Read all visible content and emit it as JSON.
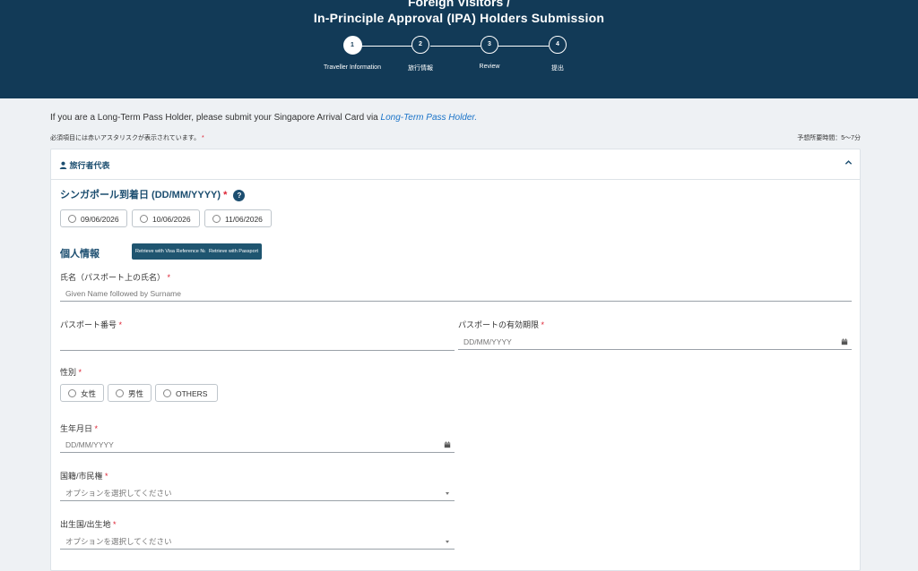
{
  "header": {
    "title_line1": "Foreign Visitors /",
    "title_line2": "In-Principle Approval (IPA) Holders Submission",
    "steps": [
      {
        "number": "1",
        "label": "Traveller Information"
      },
      {
        "number": "2",
        "label": "旅行情報"
      },
      {
        "number": "3",
        "label": "Review"
      },
      {
        "number": "4",
        "label": "提出"
      }
    ]
  },
  "notice": {
    "text": "If you are a Long-Term Pass Holder, please submit your Singapore Arrival Card via ",
    "link": "Long-Term Pass Holder."
  },
  "required_note": "必須項目には赤いアスタリスクが表示されています。",
  "required_star": "*",
  "time_estimate": "予想所要時間：5〜7分",
  "section": {
    "title": "旅行者代表",
    "arrival_label": "シンガポール到着日 (DD/MM/YYYY)",
    "info_symbol": "?",
    "arrival_options": [
      "09/06/2026",
      "10/06/2026",
      "11/06/2026"
    ],
    "personal_label": "個人情報",
    "retrieve_visa": "Retrieve with Visa Reference Number",
    "retrieve_passport": "Retrieve with Passport",
    "name_label": "氏名（パスポート上の氏名）",
    "name_placeholder": "Given Name followed by Surname",
    "passport_number_label": "パスポート番号",
    "passport_number_value": "",
    "passport_expiry_label": "パスポートの有効期限",
    "passport_expiry_placeholder": "DD/MM/YYYY",
    "gender_label": "性別",
    "gender_options": [
      "女性",
      "男性",
      "OTHERS"
    ],
    "dob_label": "生年月日",
    "dob_placeholder": "DD/MM/YYYY",
    "nationality_label": "国籍/市民権",
    "nationality_placeholder": "オプションを選択してください",
    "birthplace_label": "出生国/出生地",
    "birthplace_placeholder": "オプションを選択してください"
  },
  "colors": {
    "banner": "#123a57",
    "accent": "#1c4e70",
    "button": "#1f5570",
    "required": "#dd2233",
    "link": "#1a73c8"
  },
  "icons": {
    "person": "person-icon",
    "chevron": "chevron-up-icon",
    "calendar": "calendar-icon",
    "dropdown": "caret-down-icon",
    "info": "info-icon"
  }
}
